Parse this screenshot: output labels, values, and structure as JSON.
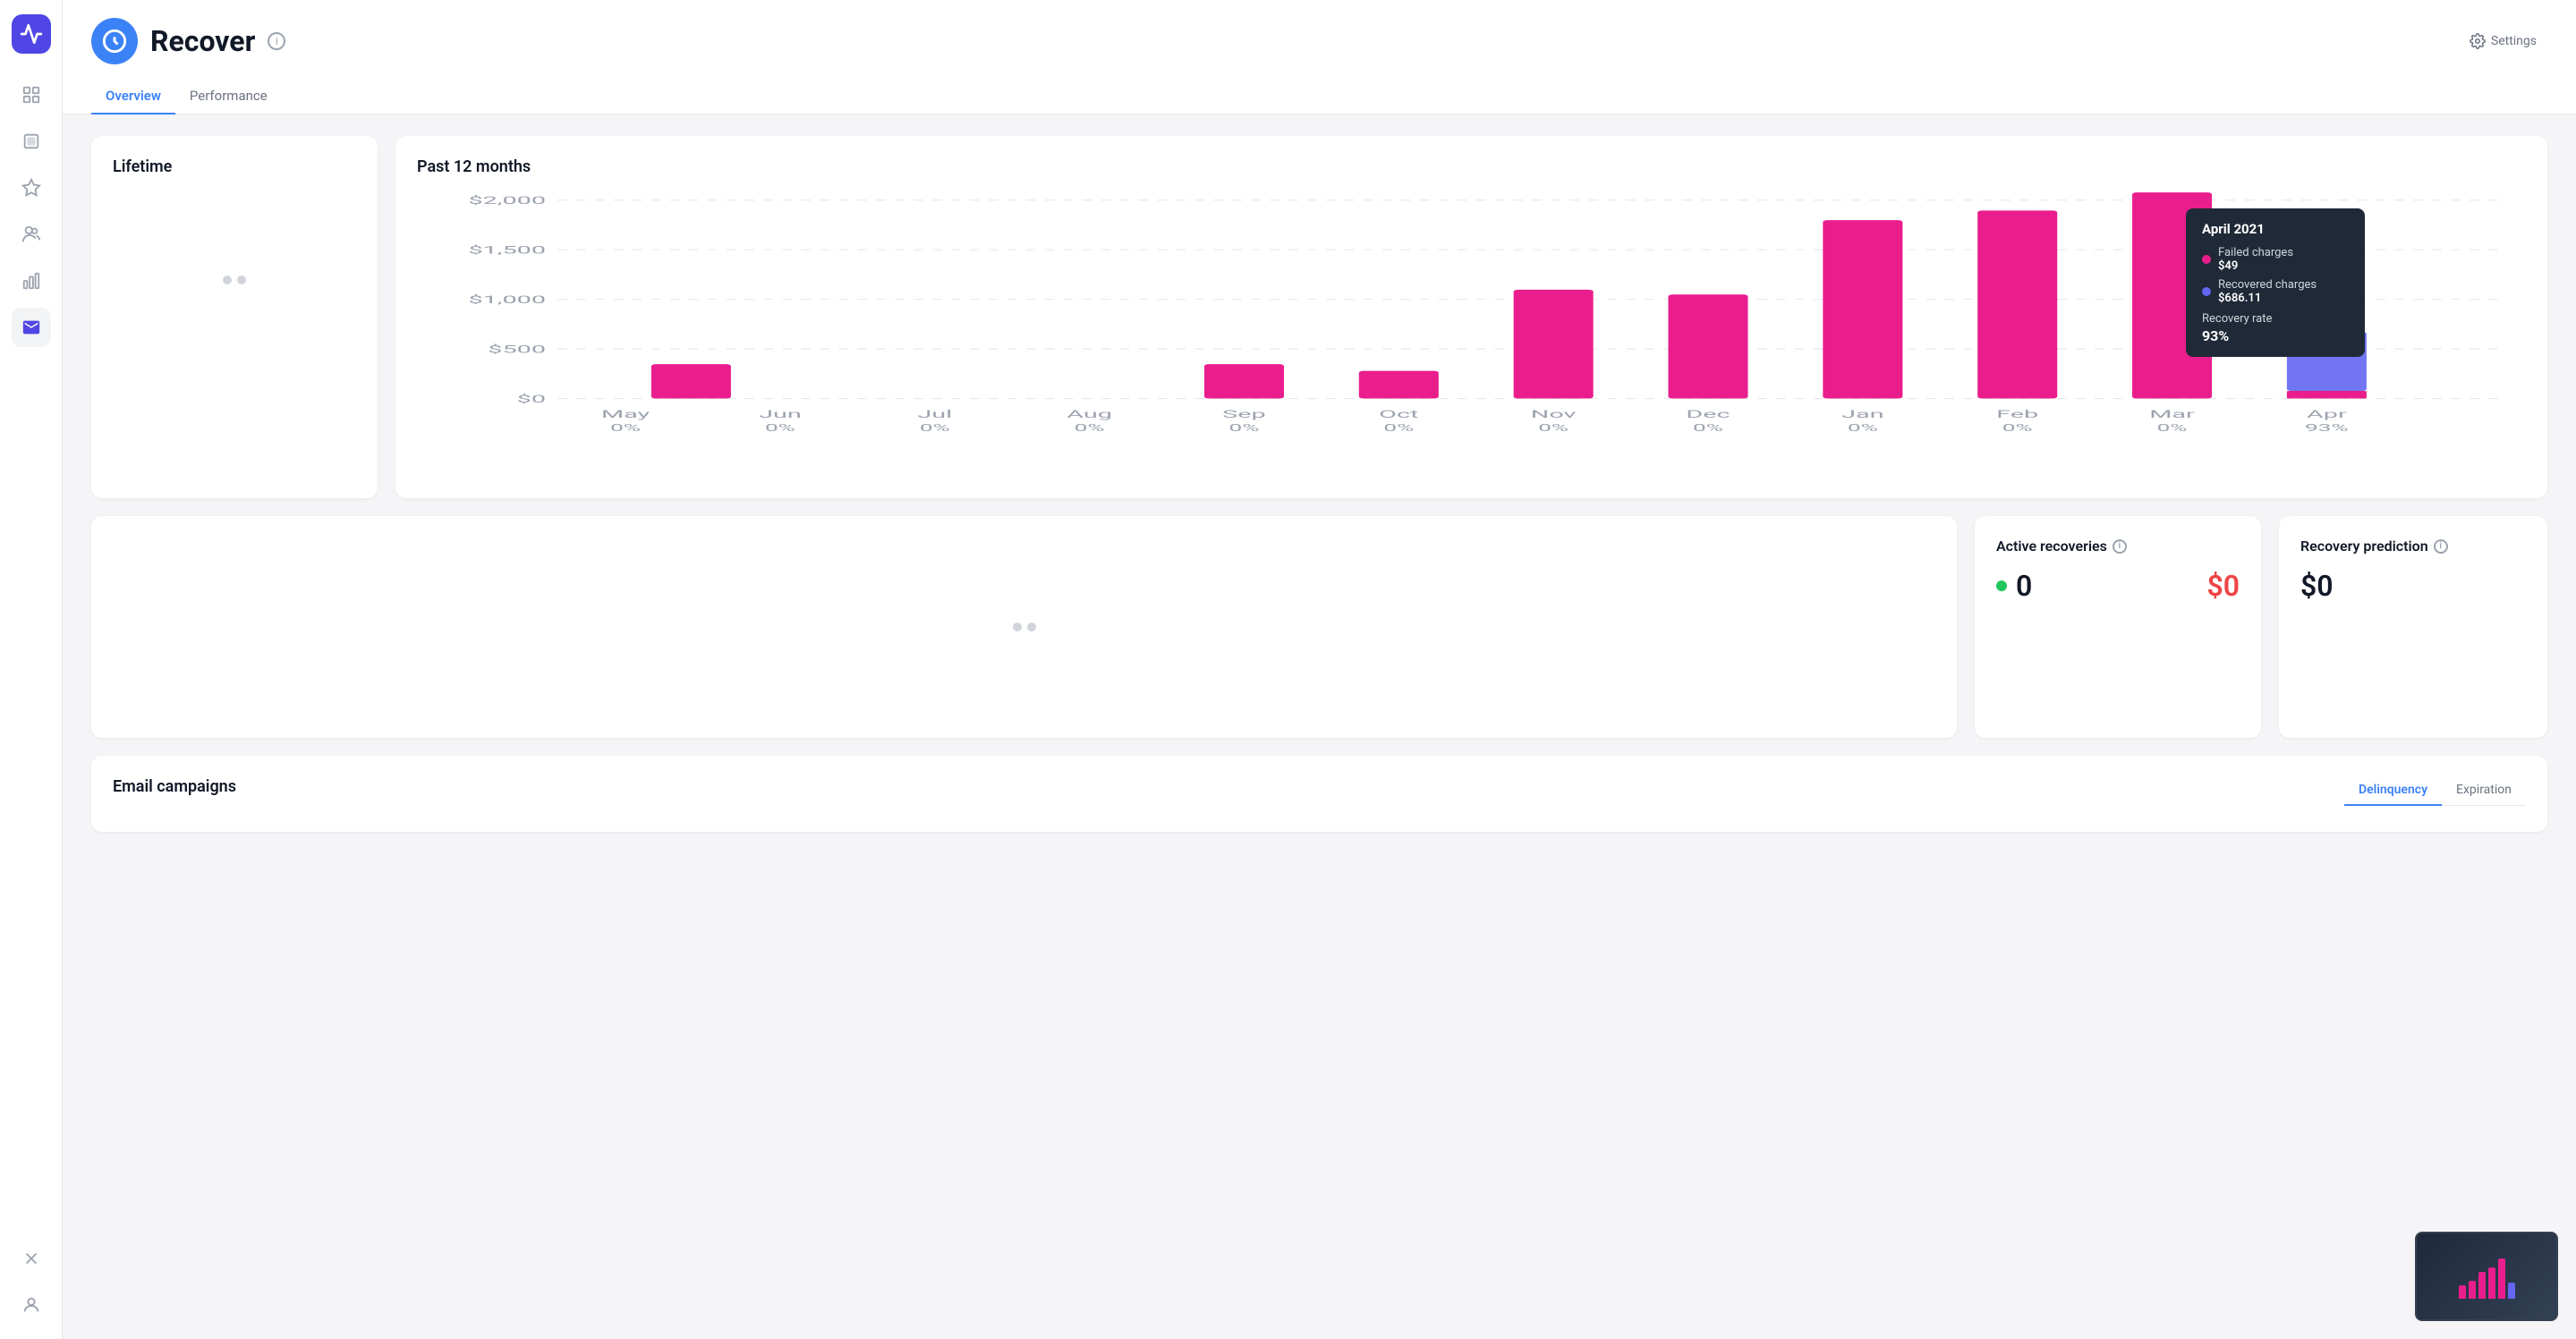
{
  "app": {
    "logo_icon": "zigzag-icon",
    "title": "Recover",
    "info_tooltip": "Information about Recover"
  },
  "sidebar": {
    "items": [
      {
        "id": "grid-icon",
        "label": "Dashboard",
        "active": false
      },
      {
        "id": "square-icon",
        "label": "Module",
        "active": false
      },
      {
        "id": "triangle-icon",
        "label": "Tasks",
        "active": false
      },
      {
        "id": "people-icon",
        "label": "People",
        "active": false
      },
      {
        "id": "chart-icon",
        "label": "Analytics",
        "active": false
      },
      {
        "id": "mail-icon",
        "label": "Messages",
        "active": true
      }
    ],
    "bottom_items": [
      {
        "id": "close-icon",
        "label": "Close"
      },
      {
        "id": "user-icon",
        "label": "Profile"
      }
    ]
  },
  "header": {
    "title": "Recover",
    "tabs": [
      {
        "id": "overview",
        "label": "Overview",
        "active": true
      },
      {
        "id": "performance",
        "label": "Performance",
        "active": false
      }
    ],
    "settings_label": "Settings"
  },
  "lifetime_card": {
    "title": "Lifetime"
  },
  "chart_card": {
    "title": "Past 12 months",
    "y_labels": [
      "$2,000",
      "$1,500",
      "$1,000",
      "$500",
      "$0"
    ],
    "months": [
      {
        "label": "May",
        "pct": "0%",
        "failed": 0,
        "recovered": 0
      },
      {
        "label": "Jun",
        "pct": "0%",
        "failed": 0,
        "recovered": 0
      },
      {
        "label": "Jul",
        "pct": "0%",
        "failed": 0,
        "recovered": 0
      },
      {
        "label": "Aug",
        "pct": "0%",
        "failed": 0,
        "recovered": 0
      },
      {
        "label": "Sep",
        "pct": "0%",
        "failed": 0,
        "recovered": 350
      },
      {
        "label": "Oct",
        "pct": "0%",
        "failed": 0,
        "recovered": 280
      },
      {
        "label": "Nov",
        "pct": "0%",
        "failed": 0,
        "recovered": 1100
      },
      {
        "label": "Dec",
        "pct": "0%",
        "failed": 0,
        "recovered": 1050
      },
      {
        "label": "Jan",
        "pct": "0%",
        "failed": 0,
        "recovered": 1800
      },
      {
        "label": "Feb",
        "pct": "0%",
        "failed": 0,
        "recovered": 1900
      },
      {
        "label": "Mar",
        "pct": "0%",
        "failed": 0,
        "recovered": 2100
      },
      {
        "label": "Apr",
        "pct": "93%",
        "failed": 49,
        "recovered": 686.11
      }
    ],
    "tooltip": {
      "month": "April 2021",
      "failed_label": "Failed charges",
      "failed_value": "$49",
      "recovered_label": "Recovered charges",
      "recovered_value": "$686.11",
      "rate_label": "Recovery rate",
      "rate_value": "93%"
    }
  },
  "active_recoveries": {
    "title": "Active recoveries",
    "count": "0",
    "amount": "$0"
  },
  "recovery_prediction": {
    "title": "Recovery prediction",
    "amount": "$0"
  },
  "email_campaigns": {
    "title": "Email campaigns",
    "tabs": [
      {
        "id": "delinquency",
        "label": "Delinquency",
        "active": true
      },
      {
        "id": "expiration",
        "label": "Expiration",
        "active": false
      }
    ]
  },
  "colors": {
    "pink": "#e91e8c",
    "blue": "#4f46e5",
    "blue_light": "#6366f1",
    "tooltip_bg": "#1f2937",
    "active_tab": "#3b82f6"
  }
}
